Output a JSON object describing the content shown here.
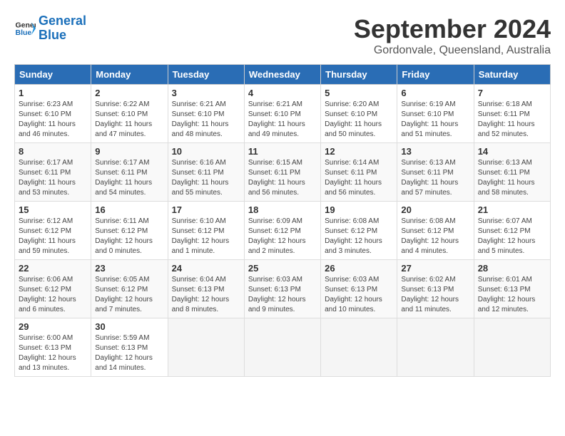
{
  "logo": {
    "line1": "General",
    "line2": "Blue"
  },
  "title": "September 2024",
  "location": "Gordonvale, Queensland, Australia",
  "weekdays": [
    "Sunday",
    "Monday",
    "Tuesday",
    "Wednesday",
    "Thursday",
    "Friday",
    "Saturday"
  ],
  "weeks": [
    [
      {
        "day": 1,
        "sunrise": "6:23 AM",
        "sunset": "6:10 PM",
        "daylight": "11 hours and 46 minutes."
      },
      {
        "day": 2,
        "sunrise": "6:22 AM",
        "sunset": "6:10 PM",
        "daylight": "11 hours and 47 minutes."
      },
      {
        "day": 3,
        "sunrise": "6:21 AM",
        "sunset": "6:10 PM",
        "daylight": "11 hours and 48 minutes."
      },
      {
        "day": 4,
        "sunrise": "6:21 AM",
        "sunset": "6:10 PM",
        "daylight": "11 hours and 49 minutes."
      },
      {
        "day": 5,
        "sunrise": "6:20 AM",
        "sunset": "6:10 PM",
        "daylight": "11 hours and 50 minutes."
      },
      {
        "day": 6,
        "sunrise": "6:19 AM",
        "sunset": "6:10 PM",
        "daylight": "11 hours and 51 minutes."
      },
      {
        "day": 7,
        "sunrise": "6:18 AM",
        "sunset": "6:11 PM",
        "daylight": "11 hours and 52 minutes."
      }
    ],
    [
      {
        "day": 8,
        "sunrise": "6:17 AM",
        "sunset": "6:11 PM",
        "daylight": "11 hours and 53 minutes."
      },
      {
        "day": 9,
        "sunrise": "6:17 AM",
        "sunset": "6:11 PM",
        "daylight": "11 hours and 54 minutes."
      },
      {
        "day": 10,
        "sunrise": "6:16 AM",
        "sunset": "6:11 PM",
        "daylight": "11 hours and 55 minutes."
      },
      {
        "day": 11,
        "sunrise": "6:15 AM",
        "sunset": "6:11 PM",
        "daylight": "11 hours and 56 minutes."
      },
      {
        "day": 12,
        "sunrise": "6:14 AM",
        "sunset": "6:11 PM",
        "daylight": "11 hours and 56 minutes."
      },
      {
        "day": 13,
        "sunrise": "6:13 AM",
        "sunset": "6:11 PM",
        "daylight": "11 hours and 57 minutes."
      },
      {
        "day": 14,
        "sunrise": "6:13 AM",
        "sunset": "6:11 PM",
        "daylight": "11 hours and 58 minutes."
      }
    ],
    [
      {
        "day": 15,
        "sunrise": "6:12 AM",
        "sunset": "6:12 PM",
        "daylight": "11 hours and 59 minutes."
      },
      {
        "day": 16,
        "sunrise": "6:11 AM",
        "sunset": "6:12 PM",
        "daylight": "12 hours and 0 minutes."
      },
      {
        "day": 17,
        "sunrise": "6:10 AM",
        "sunset": "6:12 PM",
        "daylight": "12 hours and 1 minute."
      },
      {
        "day": 18,
        "sunrise": "6:09 AM",
        "sunset": "6:12 PM",
        "daylight": "12 hours and 2 minutes."
      },
      {
        "day": 19,
        "sunrise": "6:08 AM",
        "sunset": "6:12 PM",
        "daylight": "12 hours and 3 minutes."
      },
      {
        "day": 20,
        "sunrise": "6:08 AM",
        "sunset": "6:12 PM",
        "daylight": "12 hours and 4 minutes."
      },
      {
        "day": 21,
        "sunrise": "6:07 AM",
        "sunset": "6:12 PM",
        "daylight": "12 hours and 5 minutes."
      }
    ],
    [
      {
        "day": 22,
        "sunrise": "6:06 AM",
        "sunset": "6:12 PM",
        "daylight": "12 hours and 6 minutes."
      },
      {
        "day": 23,
        "sunrise": "6:05 AM",
        "sunset": "6:12 PM",
        "daylight": "12 hours and 7 minutes."
      },
      {
        "day": 24,
        "sunrise": "6:04 AM",
        "sunset": "6:13 PM",
        "daylight": "12 hours and 8 minutes."
      },
      {
        "day": 25,
        "sunrise": "6:03 AM",
        "sunset": "6:13 PM",
        "daylight": "12 hours and 9 minutes."
      },
      {
        "day": 26,
        "sunrise": "6:03 AM",
        "sunset": "6:13 PM",
        "daylight": "12 hours and 10 minutes."
      },
      {
        "day": 27,
        "sunrise": "6:02 AM",
        "sunset": "6:13 PM",
        "daylight": "12 hours and 11 minutes."
      },
      {
        "day": 28,
        "sunrise": "6:01 AM",
        "sunset": "6:13 PM",
        "daylight": "12 hours and 12 minutes."
      }
    ],
    [
      {
        "day": 29,
        "sunrise": "6:00 AM",
        "sunset": "6:13 PM",
        "daylight": "12 hours and 13 minutes."
      },
      {
        "day": 30,
        "sunrise": "5:59 AM",
        "sunset": "6:13 PM",
        "daylight": "12 hours and 14 minutes."
      },
      null,
      null,
      null,
      null,
      null
    ]
  ]
}
